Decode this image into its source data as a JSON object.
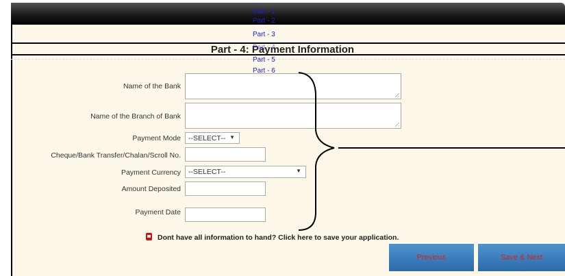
{
  "nav": {
    "parts": [
      "Part - 1",
      "Part - 2",
      "Part - 3",
      "Part - 4",
      "Part - 5",
      "Part - 6"
    ],
    "color": "#2020d0"
  },
  "page_title": "Part - 4: Payment Information",
  "form": {
    "bank_name_label": "Name of the Bank",
    "branch_name_label": "Name of the Branch of Bank",
    "payment_mode_label": "Payment Mode",
    "payment_mode_value": "--SELECT--",
    "cheque_label": "Cheque/Bank Transfer/Chalan/Scroll No.",
    "currency_label": "Payment Currency",
    "currency_value": "--SELECT--",
    "amount_label": "Amount Deposited",
    "date_label": "Payment Date"
  },
  "save_note": "Dont have all information to hand? Click here to save your application.",
  "buttons": {
    "previous": "Previous",
    "save_next": "Save & Next"
  },
  "icons": {
    "dropdown": "chevron-down-icon",
    "save": "save-icon"
  }
}
